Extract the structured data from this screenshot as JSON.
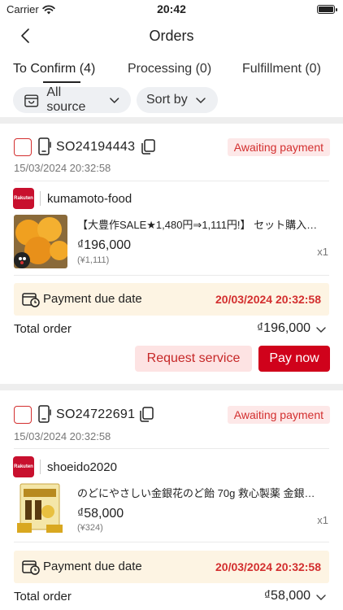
{
  "status_bar": {
    "carrier": "Carrier",
    "time": "20:42"
  },
  "header": {
    "title": "Orders"
  },
  "tabs": [
    {
      "label": "To Confirm (4)"
    },
    {
      "label": "Processing (0)"
    },
    {
      "label": "Fulfillment (0)"
    }
  ],
  "filters": {
    "source_label": "All source",
    "sort_label": "Sort by"
  },
  "colors": {
    "accent": "#d0021b",
    "badge_bg": "#fde8e8",
    "due_bg": "#fdf4e3"
  },
  "orders": [
    {
      "code": "SO24194443",
      "status": "Awaiting payment",
      "datetime": "15/03/2024 20:32:58",
      "shop_logo_text": "Rakuten",
      "shop": "kumamoto-food",
      "product_name": "【大豊作SALE★1,480円⇒1,111円!】 セット購入…",
      "price": "₫196,000",
      "price_original": "(¥1,111)",
      "quantity": "x1",
      "due_label": "Payment due date",
      "due_date": "20/03/2024 20:32:58",
      "total_label": "Total order",
      "total": "₫196,000",
      "request_service_label": "Request service",
      "pay_now_label": "Pay now"
    },
    {
      "code": "SO24722691",
      "status": "Awaiting payment",
      "datetime": "15/03/2024 20:32:58",
      "shop_logo_text": "Rakuten",
      "shop": "shoeido2020",
      "product_name": "のどにやさしい金銀花のど飴 70g 救心製薬 金銀…",
      "price": "₫58,000",
      "price_original": "(¥324)",
      "quantity": "x1",
      "due_label": "Payment due date",
      "due_date": "20/03/2024 20:32:58",
      "total_label": "Total order",
      "total": "₫58,000"
    }
  ]
}
